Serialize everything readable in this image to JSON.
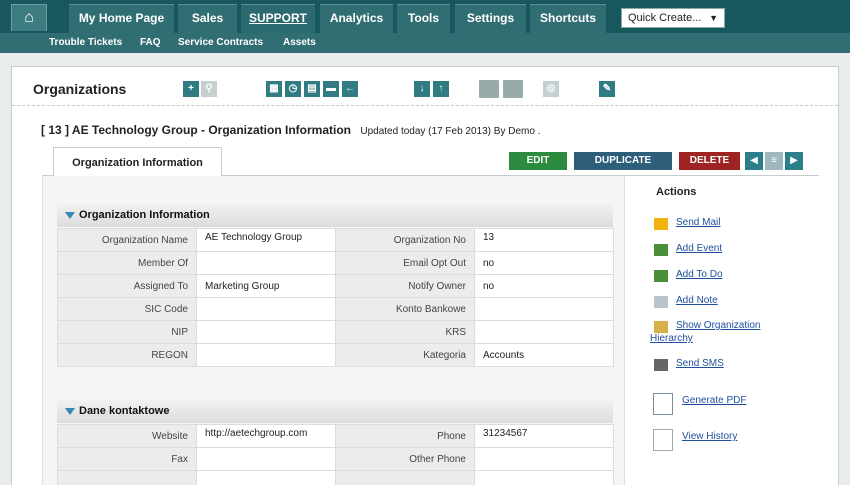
{
  "nav": {
    "home_icon": "home-icon",
    "tabs": [
      {
        "label": "My Home Page"
      },
      {
        "label": "Sales"
      },
      {
        "label": "SUPPORT"
      },
      {
        "label": "Analytics"
      },
      {
        "label": "Tools"
      },
      {
        "label": "Settings"
      },
      {
        "label": "Shortcuts"
      }
    ],
    "quick_create": "Quick Create...",
    "sub_items": [
      "Trouble Tickets",
      "FAQ",
      "Service Contracts",
      "Assets"
    ]
  },
  "module": {
    "title": "Organizations"
  },
  "record": {
    "title": "[ 13 ] AE Technology Group - Organization Information",
    "updated": "Updated today (17 Feb 2013) By Demo ."
  },
  "detail_tab": "Organization Information",
  "buttons": {
    "edit": "EDIT",
    "duplicate": "DUPLICATE",
    "delete": "DELETE"
  },
  "org_block": {
    "title": "Organization Information",
    "rows": [
      {
        "l1": "Organization Name",
        "v1": "AE Technology Group",
        "l2": "Organization No",
        "v2": "13"
      },
      {
        "l1": "Member Of",
        "v1": "",
        "l2": "Email Opt Out",
        "v2": "no"
      },
      {
        "l1": "Assigned To",
        "v1": "Marketing Group",
        "l2": "Notify Owner",
        "v2": "no"
      },
      {
        "l1": "SIC Code",
        "v1": "",
        "l2": "Konto Bankowe",
        "v2": ""
      },
      {
        "l1": "NIP",
        "v1": "",
        "l2": "KRS",
        "v2": ""
      },
      {
        "l1": "REGON",
        "v1": "",
        "l2": "Kategoria",
        "v2": "Accounts"
      }
    ]
  },
  "contact_block": {
    "title": "Dane kontaktowe",
    "rows": [
      {
        "l1": "Website",
        "v1": "http://aetechgroup.com",
        "l2": "Phone",
        "v2": "31234567"
      },
      {
        "l1": "Fax",
        "v1": "",
        "l2": "Other Phone",
        "v2": ""
      },
      {
        "l1": "",
        "v1": "",
        "l2": "",
        "v2": ""
      }
    ]
  },
  "actions": {
    "title": "Actions",
    "items": [
      {
        "label": "Send Mail",
        "icon": "mail-icon"
      },
      {
        "label": "Add Event",
        "icon": "event-icon"
      },
      {
        "label": "Add To Do",
        "icon": "todo-icon"
      },
      {
        "label": "Add Note",
        "icon": "note-icon"
      },
      {
        "label": "Show Organization",
        "label2": "Hierarchy",
        "icon": "hierarchy-icon"
      },
      {
        "label": "Send SMS",
        "icon": "sms-icon"
      },
      {
        "label": "Generate PDF",
        "icon": "pdf-icon"
      },
      {
        "label": "View History",
        "icon": "history-icon"
      }
    ]
  },
  "colors": {
    "topbar": "#17575d",
    "tab": "#316e74",
    "edit": "#2b8b3f",
    "duplicate": "#2d5f7a",
    "delete": "#9f2323"
  }
}
